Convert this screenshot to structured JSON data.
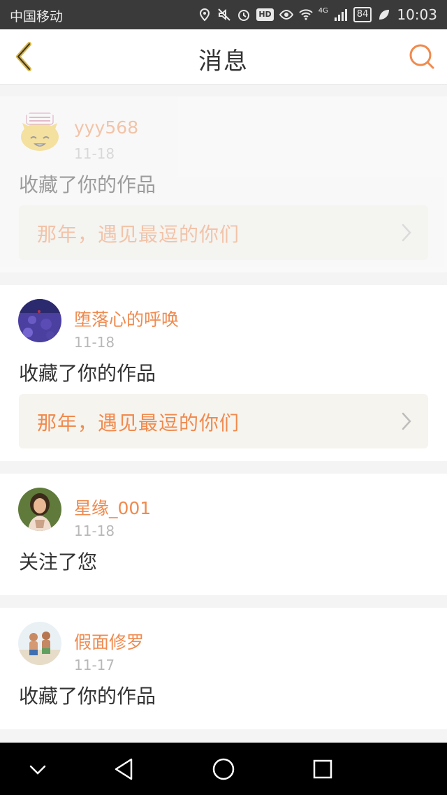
{
  "status_bar": {
    "carrier": "中国移动",
    "network": "4G",
    "hd": "HD",
    "battery": "84",
    "time": "10:03"
  },
  "header": {
    "title": "消息",
    "back_icon": "back-chevron-icon",
    "search_icon": "search-icon"
  },
  "messages": [
    {
      "username": "yyy568",
      "date": "11-18",
      "action": "收藏了你的作品",
      "work_title": "那年，遇见最逗的你们",
      "avatar": "cartoon-face-avatar"
    },
    {
      "username": "堕落心的呼唤",
      "date": "11-18",
      "action": "收藏了你的作品",
      "work_title": "那年，遇见最逗的你们",
      "avatar": "lavender-field-avatar"
    },
    {
      "username": "星缘_001",
      "date": "11-18",
      "action": "关注了您",
      "avatar": "girl-photo-avatar"
    },
    {
      "username": "假面修罗",
      "date": "11-17",
      "action": "收藏了你的作品",
      "avatar": "beach-kids-avatar"
    }
  ],
  "colors": {
    "accent": "#f08a4e",
    "header_bg": "#ffffff",
    "page_bg": "#f4f4f4",
    "status_bg": "#3a3a3a",
    "nav_bg": "#000000"
  }
}
